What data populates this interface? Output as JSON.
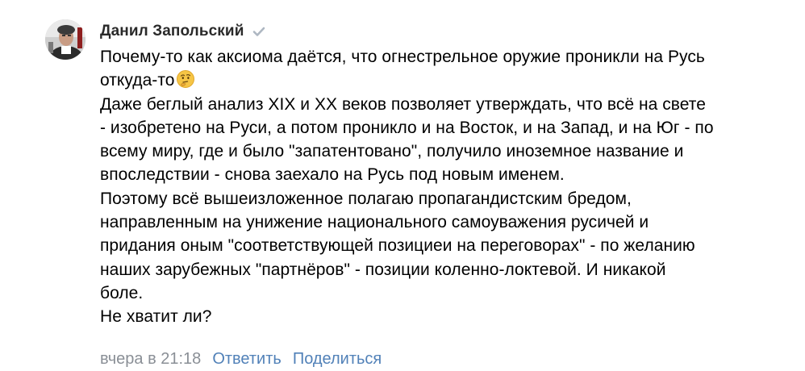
{
  "comment": {
    "author": {
      "name": "Данил Запольский",
      "verified_icon": "checkmark-icon",
      "avatar": "avatar-photo"
    },
    "text_lines": [
      "Почему-то как аксиома даётся, что огнестрельное оружие проникли на Русь",
      "откуда-то",
      "Даже беглый анализ XIX и XX веков позволяет утверждать, что всё на свете",
      "- изобретено на Руси, а потом проникло и на Восток, и на Запад, и на Юг - по",
      "всему миру, где и было \"запатентовано\", получило иноземное название и",
      "впоследствии - снова заехало на Русь под новым именем.",
      "Поэтому всё вышеизложенное полагаю пропагандистским бредом,",
      "направленным на унижение национального самоуважения русичей и",
      "придания оным \"соответствующей позициеи на переговорах\" - по желанию",
      "наших зарубежных \"партнёров\" - позиции коленно-локтевой. И никакой",
      "боле.",
      "Не хватит ли?"
    ],
    "emoji": "thinking-face-emoji",
    "timestamp": "вчера в 21:18",
    "actions": {
      "reply": "Ответить",
      "share": "Поделиться"
    }
  },
  "colors": {
    "link": "#5181b8",
    "meta": "#8a8f96",
    "author": "#2a2a2a",
    "text": "#000000"
  }
}
